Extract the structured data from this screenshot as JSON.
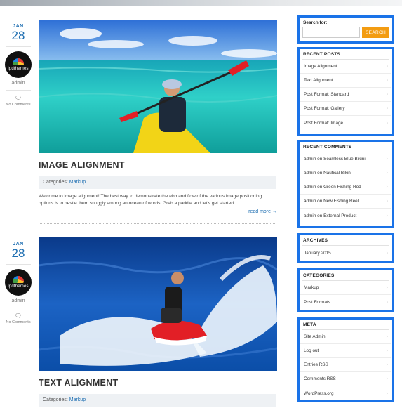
{
  "posts": [
    {
      "date": {
        "month": "JAN",
        "day": "28"
      },
      "author": "admin",
      "avatar_text": "lpdthemes",
      "comments": "No Comments",
      "title": "IMAGE ALIGNMENT",
      "categories_label": "Categories:",
      "category": "Markup",
      "excerpt": "Welcome to image alignment! The best way to demonstrate the ebb and flow of the various image positioning options is to nestle them snuggly among an ocean of words. Grab a paddle and let's get started.",
      "read_more": "read more →"
    },
    {
      "date": {
        "month": "JAN",
        "day": "28"
      },
      "author": "admin",
      "avatar_text": "lpdthemes",
      "comments": "No Comments",
      "title": "TEXT ALIGNMENT",
      "categories_label": "Categories:",
      "category": "Markup"
    }
  ],
  "sidebar": {
    "search": {
      "label": "Search for:",
      "button": "SEARCH",
      "value": ""
    },
    "recent_posts": {
      "title": "RECENT POSTS",
      "items": [
        "Image Alignment",
        "Text Alignment",
        "Post Format: Standard",
        "Post Format: Gallery",
        "Post Format: Image"
      ]
    },
    "recent_comments": {
      "title": "RECENT COMMENTS",
      "items": [
        "admin on Seamless Blue Bikini",
        "admin on Nautical Bikini",
        "admin on Green Fishing Rod",
        "admin on New Fishing Reel",
        "admin on External Product"
      ]
    },
    "archives": {
      "title": "ARCHIVES",
      "items": [
        "January 2015"
      ]
    },
    "categories": {
      "title": "CATEGORIES",
      "items": [
        "Markup",
        "Post Formats"
      ]
    },
    "meta": {
      "title": "META",
      "items": [
        "Site Admin",
        "Log out",
        "Entries RSS",
        "Comments RSS",
        "WordPress.org"
      ]
    }
  },
  "icons": {
    "comment": "comment-icon",
    "chevron": "chevron-right-icon"
  },
  "colors": {
    "accent": "#1f6fb2",
    "search_button": "#f39c12",
    "widget_border": "#1a73e8"
  }
}
